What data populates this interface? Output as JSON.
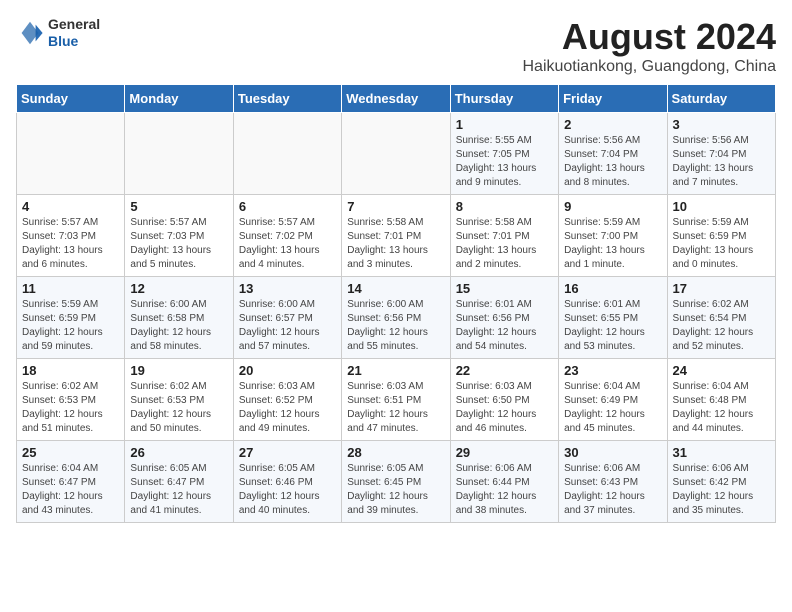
{
  "header": {
    "logo": {
      "general": "General",
      "blue": "Blue"
    },
    "title": "August 2024",
    "subtitle": "Haikuotiankong, Guangdong, China"
  },
  "weekdays": [
    "Sunday",
    "Monday",
    "Tuesday",
    "Wednesday",
    "Thursday",
    "Friday",
    "Saturday"
  ],
  "weeks": [
    [
      {
        "day": "",
        "info": ""
      },
      {
        "day": "",
        "info": ""
      },
      {
        "day": "",
        "info": ""
      },
      {
        "day": "",
        "info": ""
      },
      {
        "day": "1",
        "info": "Sunrise: 5:55 AM\nSunset: 7:05 PM\nDaylight: 13 hours\nand 9 minutes."
      },
      {
        "day": "2",
        "info": "Sunrise: 5:56 AM\nSunset: 7:04 PM\nDaylight: 13 hours\nand 8 minutes."
      },
      {
        "day": "3",
        "info": "Sunrise: 5:56 AM\nSunset: 7:04 PM\nDaylight: 13 hours\nand 7 minutes."
      }
    ],
    [
      {
        "day": "4",
        "info": "Sunrise: 5:57 AM\nSunset: 7:03 PM\nDaylight: 13 hours\nand 6 minutes."
      },
      {
        "day": "5",
        "info": "Sunrise: 5:57 AM\nSunset: 7:03 PM\nDaylight: 13 hours\nand 5 minutes."
      },
      {
        "day": "6",
        "info": "Sunrise: 5:57 AM\nSunset: 7:02 PM\nDaylight: 13 hours\nand 4 minutes."
      },
      {
        "day": "7",
        "info": "Sunrise: 5:58 AM\nSunset: 7:01 PM\nDaylight: 13 hours\nand 3 minutes."
      },
      {
        "day": "8",
        "info": "Sunrise: 5:58 AM\nSunset: 7:01 PM\nDaylight: 13 hours\nand 2 minutes."
      },
      {
        "day": "9",
        "info": "Sunrise: 5:59 AM\nSunset: 7:00 PM\nDaylight: 13 hours\nand 1 minute."
      },
      {
        "day": "10",
        "info": "Sunrise: 5:59 AM\nSunset: 6:59 PM\nDaylight: 13 hours\nand 0 minutes."
      }
    ],
    [
      {
        "day": "11",
        "info": "Sunrise: 5:59 AM\nSunset: 6:59 PM\nDaylight: 12 hours\nand 59 minutes."
      },
      {
        "day": "12",
        "info": "Sunrise: 6:00 AM\nSunset: 6:58 PM\nDaylight: 12 hours\nand 58 minutes."
      },
      {
        "day": "13",
        "info": "Sunrise: 6:00 AM\nSunset: 6:57 PM\nDaylight: 12 hours\nand 57 minutes."
      },
      {
        "day": "14",
        "info": "Sunrise: 6:00 AM\nSunset: 6:56 PM\nDaylight: 12 hours\nand 55 minutes."
      },
      {
        "day": "15",
        "info": "Sunrise: 6:01 AM\nSunset: 6:56 PM\nDaylight: 12 hours\nand 54 minutes."
      },
      {
        "day": "16",
        "info": "Sunrise: 6:01 AM\nSunset: 6:55 PM\nDaylight: 12 hours\nand 53 minutes."
      },
      {
        "day": "17",
        "info": "Sunrise: 6:02 AM\nSunset: 6:54 PM\nDaylight: 12 hours\nand 52 minutes."
      }
    ],
    [
      {
        "day": "18",
        "info": "Sunrise: 6:02 AM\nSunset: 6:53 PM\nDaylight: 12 hours\nand 51 minutes."
      },
      {
        "day": "19",
        "info": "Sunrise: 6:02 AM\nSunset: 6:53 PM\nDaylight: 12 hours\nand 50 minutes."
      },
      {
        "day": "20",
        "info": "Sunrise: 6:03 AM\nSunset: 6:52 PM\nDaylight: 12 hours\nand 49 minutes."
      },
      {
        "day": "21",
        "info": "Sunrise: 6:03 AM\nSunset: 6:51 PM\nDaylight: 12 hours\nand 47 minutes."
      },
      {
        "day": "22",
        "info": "Sunrise: 6:03 AM\nSunset: 6:50 PM\nDaylight: 12 hours\nand 46 minutes."
      },
      {
        "day": "23",
        "info": "Sunrise: 6:04 AM\nSunset: 6:49 PM\nDaylight: 12 hours\nand 45 minutes."
      },
      {
        "day": "24",
        "info": "Sunrise: 6:04 AM\nSunset: 6:48 PM\nDaylight: 12 hours\nand 44 minutes."
      }
    ],
    [
      {
        "day": "25",
        "info": "Sunrise: 6:04 AM\nSunset: 6:47 PM\nDaylight: 12 hours\nand 43 minutes."
      },
      {
        "day": "26",
        "info": "Sunrise: 6:05 AM\nSunset: 6:47 PM\nDaylight: 12 hours\nand 41 minutes."
      },
      {
        "day": "27",
        "info": "Sunrise: 6:05 AM\nSunset: 6:46 PM\nDaylight: 12 hours\nand 40 minutes."
      },
      {
        "day": "28",
        "info": "Sunrise: 6:05 AM\nSunset: 6:45 PM\nDaylight: 12 hours\nand 39 minutes."
      },
      {
        "day": "29",
        "info": "Sunrise: 6:06 AM\nSunset: 6:44 PM\nDaylight: 12 hours\nand 38 minutes."
      },
      {
        "day": "30",
        "info": "Sunrise: 6:06 AM\nSunset: 6:43 PM\nDaylight: 12 hours\nand 37 minutes."
      },
      {
        "day": "31",
        "info": "Sunrise: 6:06 AM\nSunset: 6:42 PM\nDaylight: 12 hours\nand 35 minutes."
      }
    ]
  ]
}
